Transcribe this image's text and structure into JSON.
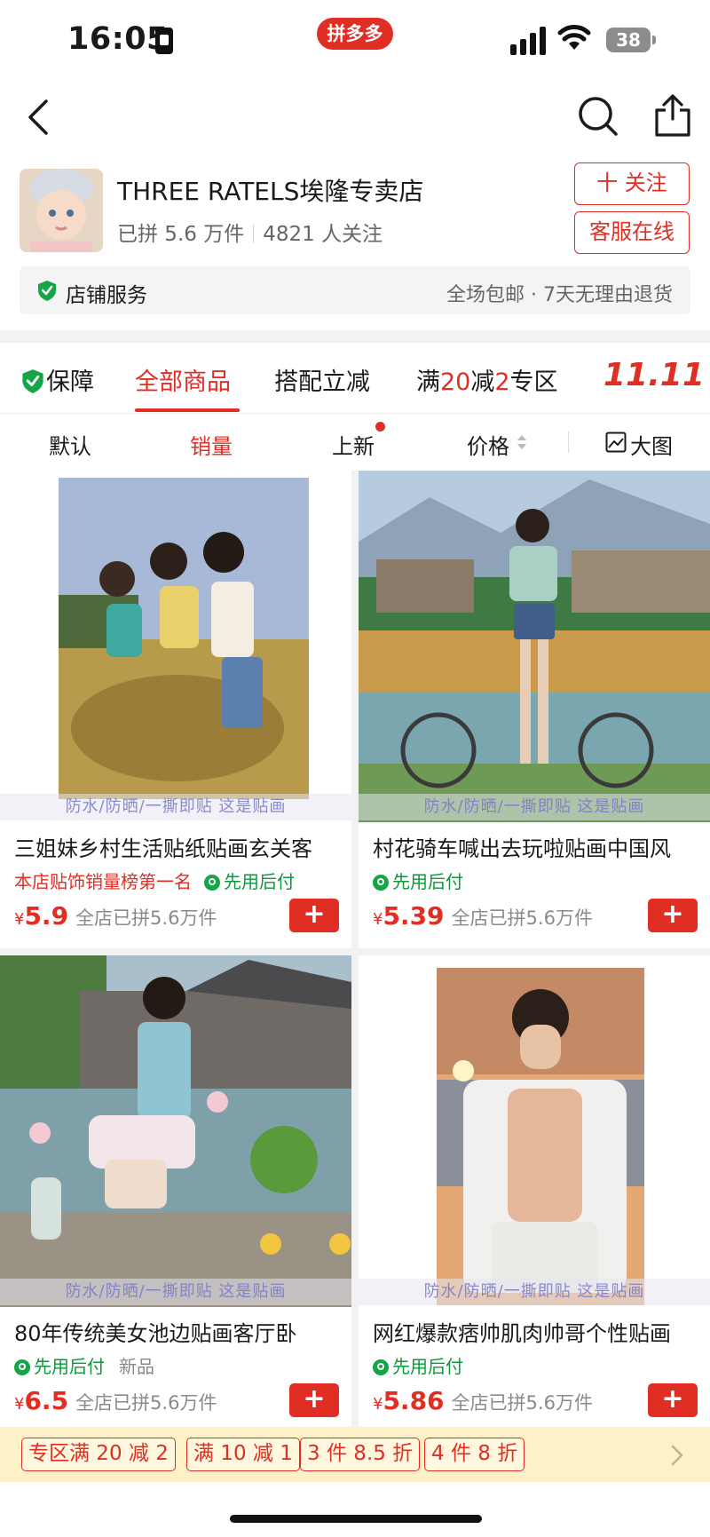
{
  "status_bar": {
    "time": "16:05",
    "app_badge": "拼多多",
    "battery": "38"
  },
  "store": {
    "name": "THREE RATELS埃隆专卖店",
    "sold": "已拼 5.6 万件",
    "followers": "4821 人关注",
    "follow_label": "十 关注",
    "service_label": "客服在线",
    "service_bar_label": "店铺服务",
    "service_bar_info": "全场包邮 · 7天无理由退货"
  },
  "tabs": {
    "guarantee": "保障",
    "all_products": "全部商品",
    "bundle": "搭配立减",
    "promo_prefix": "满",
    "promo_a": "20",
    "promo_mid": "减",
    "promo_b": "2",
    "promo_suffix": "专区",
    "event": "11.11"
  },
  "sort": {
    "default": "默认",
    "sales": "销量",
    "new": "上新",
    "price": "价格",
    "big_pic": "大图"
  },
  "watermark": "防水/防晒/一撕即贴  这是贴画",
  "products": [
    {
      "title": "三姐妹乡村生活贴纸贴画玄关客",
      "rank": "本店贴饰销量榜第一名",
      "pay": "先用后付",
      "new": "",
      "yen": "¥",
      "price": "5.9",
      "sold": "全店已拼5.6万件"
    },
    {
      "title": "村花骑车喊出去玩啦贴画中国风",
      "rank": "",
      "pay": "先用后付",
      "new": "",
      "yen": "¥",
      "price": "5.39",
      "sold": "全店已拼5.6万件"
    },
    {
      "title": "80年传统美女池边贴画客厅卧",
      "rank": "",
      "pay": "先用后付",
      "new": "新品",
      "yen": "¥",
      "price": "6.5",
      "sold": "全店已拼5.6万件"
    },
    {
      "title": "网红爆款痞帅肌肉帅哥个性贴画",
      "rank": "",
      "pay": "先用后付",
      "new": "",
      "yen": "¥",
      "price": "5.86",
      "sold": "全店已拼5.6万件"
    }
  ],
  "add_label": "+",
  "promo_tags": [
    "专区满 20 减 2",
    "满 10 减 1",
    "3 件 8.5 折",
    "4 件 8 折"
  ],
  "colors": {
    "accent": "#e02e24",
    "pay_green": "#13a546",
    "promo_bg": "#fdf1c7"
  },
  "icons": [
    "back-icon",
    "search-icon",
    "share-icon",
    "shield-icon",
    "pay-icon",
    "bigpic-icon",
    "chevron-right-icon"
  ]
}
